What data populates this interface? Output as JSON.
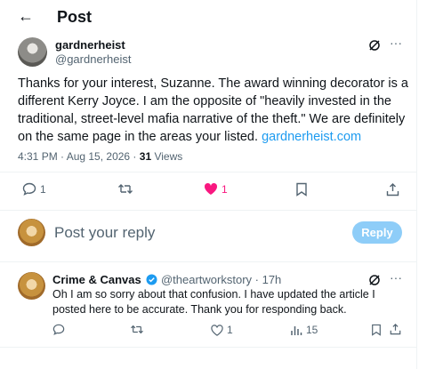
{
  "header": {
    "back_label": "←",
    "title": "Post"
  },
  "post": {
    "author_name": "gardnerheist",
    "author_handle": "@gardnerheist",
    "body": "Thanks for your interest, Suzanne.  The award winning decorator is a different Kerry Joyce. I am the opposite of \"heavily invested in the traditional, street-level mafia narrative of the theft.\" We are definitely on the same page in the areas your listed.",
    "link": "gardnerheist.com",
    "time": "4:31 PM · Aug 15, 2026 · ",
    "views_count": "31",
    "views_label": " Views",
    "actions": {
      "replies": "1",
      "reposts": "",
      "likes": "1"
    },
    "like_color": "#f91880"
  },
  "composer": {
    "placeholder": "Post your reply",
    "reply_button": "Reply"
  },
  "reply": {
    "author_name": "Crime & Canvas",
    "author_handle": "@theartworkstory",
    "time": "· 17h",
    "body": "Oh I am so sorry about that confusion. I have updated the article I posted here to be accurate. Thank you for responding back.",
    "actions": {
      "replies": "",
      "reposts": "",
      "likes": "1",
      "views": "15"
    },
    "verified_color": "#1d9bf0"
  }
}
